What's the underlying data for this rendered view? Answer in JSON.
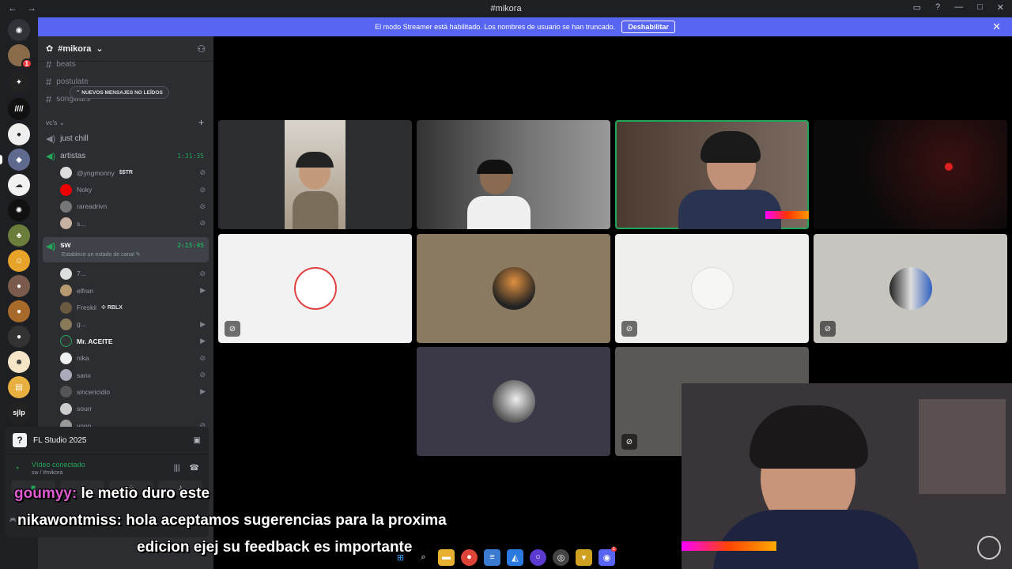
{
  "window": {
    "title": "#mikora",
    "back": "←",
    "forward": "→"
  },
  "banner": {
    "text": "El modo Streamer está habilitado. Los nombres de usuario se han truncado.",
    "button": "Deshabilitar",
    "close": "✕"
  },
  "servers": {
    "badge_top": "1",
    "sjlp": "sjlp"
  },
  "sidebar": {
    "server_name": "#mikora",
    "channels": [
      "beats",
      "postulate",
      "songwars"
    ],
    "new_messages": "NUEVOS MENSAJES NO LEÍDOS",
    "category": "vc's",
    "voice_channels": [
      {
        "name": "just chill",
        "duration": ""
      },
      {
        "name": "artistas",
        "duration": "1:31:35"
      }
    ],
    "artistas_users": [
      {
        "name": "@yngmonny",
        "tag": "$$TR"
      },
      {
        "name": "Noky",
        "tag": ""
      },
      {
        "name": "rareadrivn",
        "tag": ""
      },
      {
        "name": "s...",
        "tag": ""
      }
    ],
    "active_channel": {
      "name": "sw",
      "duration": "2:15:45",
      "status": "Establece un estado de canal"
    },
    "sw_users": [
      {
        "name": "7..."
      },
      {
        "name": "elfran"
      },
      {
        "name": "Freskii",
        "tag": "RBLX"
      },
      {
        "name": "g..."
      },
      {
        "name": "Mr. ACEITE"
      },
      {
        "name": "nika"
      },
      {
        "name": "sanx"
      },
      {
        "name": "sincericidio"
      },
      {
        "name": "sourr"
      },
      {
        "name": "yonp"
      }
    ]
  },
  "panel": {
    "app_name": "FL Studio 2025",
    "connection": "Vídeo conectado",
    "location": "sw / #mikora",
    "user_activity": "FL Studio 2025 +1"
  },
  "chat_overlay": {
    "line1_name": "goumyy:",
    "line1_text": " le metio duro este",
    "line2": "nikawontmiss: hola aceptamos sugerencias para la proxima",
    "line3": "edicion ejej su feedback es importante"
  },
  "colors": {
    "blurple": "#5865f2",
    "green": "#23a55a",
    "sidebar": "#2b2d31",
    "rail": "#1e1f22"
  }
}
